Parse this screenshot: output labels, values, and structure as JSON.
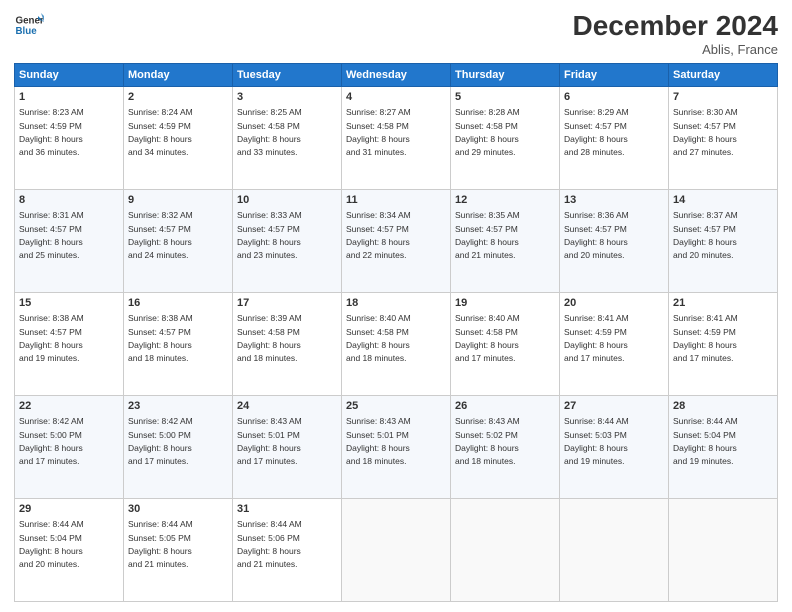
{
  "header": {
    "logo_line1": "General",
    "logo_line2": "Blue",
    "title": "December 2024",
    "location": "Ablis, France"
  },
  "columns": [
    "Sunday",
    "Monday",
    "Tuesday",
    "Wednesday",
    "Thursday",
    "Friday",
    "Saturday"
  ],
  "weeks": [
    [
      {
        "day": "1",
        "info": "Sunrise: 8:23 AM\nSunset: 4:59 PM\nDaylight: 8 hours\nand 36 minutes."
      },
      {
        "day": "2",
        "info": "Sunrise: 8:24 AM\nSunset: 4:59 PM\nDaylight: 8 hours\nand 34 minutes."
      },
      {
        "day": "3",
        "info": "Sunrise: 8:25 AM\nSunset: 4:58 PM\nDaylight: 8 hours\nand 33 minutes."
      },
      {
        "day": "4",
        "info": "Sunrise: 8:27 AM\nSunset: 4:58 PM\nDaylight: 8 hours\nand 31 minutes."
      },
      {
        "day": "5",
        "info": "Sunrise: 8:28 AM\nSunset: 4:58 PM\nDaylight: 8 hours\nand 29 minutes."
      },
      {
        "day": "6",
        "info": "Sunrise: 8:29 AM\nSunset: 4:57 PM\nDaylight: 8 hours\nand 28 minutes."
      },
      {
        "day": "7",
        "info": "Sunrise: 8:30 AM\nSunset: 4:57 PM\nDaylight: 8 hours\nand 27 minutes."
      }
    ],
    [
      {
        "day": "8",
        "info": "Sunrise: 8:31 AM\nSunset: 4:57 PM\nDaylight: 8 hours\nand 25 minutes."
      },
      {
        "day": "9",
        "info": "Sunrise: 8:32 AM\nSunset: 4:57 PM\nDaylight: 8 hours\nand 24 minutes."
      },
      {
        "day": "10",
        "info": "Sunrise: 8:33 AM\nSunset: 4:57 PM\nDaylight: 8 hours\nand 23 minutes."
      },
      {
        "day": "11",
        "info": "Sunrise: 8:34 AM\nSunset: 4:57 PM\nDaylight: 8 hours\nand 22 minutes."
      },
      {
        "day": "12",
        "info": "Sunrise: 8:35 AM\nSunset: 4:57 PM\nDaylight: 8 hours\nand 21 minutes."
      },
      {
        "day": "13",
        "info": "Sunrise: 8:36 AM\nSunset: 4:57 PM\nDaylight: 8 hours\nand 20 minutes."
      },
      {
        "day": "14",
        "info": "Sunrise: 8:37 AM\nSunset: 4:57 PM\nDaylight: 8 hours\nand 20 minutes."
      }
    ],
    [
      {
        "day": "15",
        "info": "Sunrise: 8:38 AM\nSunset: 4:57 PM\nDaylight: 8 hours\nand 19 minutes."
      },
      {
        "day": "16",
        "info": "Sunrise: 8:38 AM\nSunset: 4:57 PM\nDaylight: 8 hours\nand 18 minutes."
      },
      {
        "day": "17",
        "info": "Sunrise: 8:39 AM\nSunset: 4:58 PM\nDaylight: 8 hours\nand 18 minutes."
      },
      {
        "day": "18",
        "info": "Sunrise: 8:40 AM\nSunset: 4:58 PM\nDaylight: 8 hours\nand 18 minutes."
      },
      {
        "day": "19",
        "info": "Sunrise: 8:40 AM\nSunset: 4:58 PM\nDaylight: 8 hours\nand 17 minutes."
      },
      {
        "day": "20",
        "info": "Sunrise: 8:41 AM\nSunset: 4:59 PM\nDaylight: 8 hours\nand 17 minutes."
      },
      {
        "day": "21",
        "info": "Sunrise: 8:41 AM\nSunset: 4:59 PM\nDaylight: 8 hours\nand 17 minutes."
      }
    ],
    [
      {
        "day": "22",
        "info": "Sunrise: 8:42 AM\nSunset: 5:00 PM\nDaylight: 8 hours\nand 17 minutes."
      },
      {
        "day": "23",
        "info": "Sunrise: 8:42 AM\nSunset: 5:00 PM\nDaylight: 8 hours\nand 17 minutes."
      },
      {
        "day": "24",
        "info": "Sunrise: 8:43 AM\nSunset: 5:01 PM\nDaylight: 8 hours\nand 17 minutes."
      },
      {
        "day": "25",
        "info": "Sunrise: 8:43 AM\nSunset: 5:01 PM\nDaylight: 8 hours\nand 18 minutes."
      },
      {
        "day": "26",
        "info": "Sunrise: 8:43 AM\nSunset: 5:02 PM\nDaylight: 8 hours\nand 18 minutes."
      },
      {
        "day": "27",
        "info": "Sunrise: 8:44 AM\nSunset: 5:03 PM\nDaylight: 8 hours\nand 19 minutes."
      },
      {
        "day": "28",
        "info": "Sunrise: 8:44 AM\nSunset: 5:04 PM\nDaylight: 8 hours\nand 19 minutes."
      }
    ],
    [
      {
        "day": "29",
        "info": "Sunrise: 8:44 AM\nSunset: 5:04 PM\nDaylight: 8 hours\nand 20 minutes."
      },
      {
        "day": "30",
        "info": "Sunrise: 8:44 AM\nSunset: 5:05 PM\nDaylight: 8 hours\nand 21 minutes."
      },
      {
        "day": "31",
        "info": "Sunrise: 8:44 AM\nSunset: 5:06 PM\nDaylight: 8 hours\nand 21 minutes."
      },
      {
        "day": "",
        "info": ""
      },
      {
        "day": "",
        "info": ""
      },
      {
        "day": "",
        "info": ""
      },
      {
        "day": "",
        "info": ""
      }
    ]
  ]
}
